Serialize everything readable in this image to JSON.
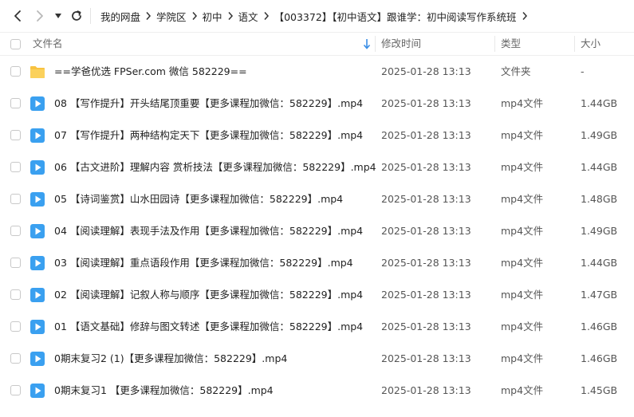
{
  "toolbar": {
    "back_icon": "chevron-left-icon",
    "forward_icon": "chevron-right-icon",
    "history_icon": "caret-down-icon",
    "refresh_icon": "refresh-icon",
    "breadcrumbs": [
      "我的网盘",
      "学院区",
      "初中",
      "语文",
      "【003372】【初中语文】跟谁学：初中阅读写作系统班"
    ]
  },
  "header": {
    "name": "文件名",
    "sort_icon": "arrow-down-icon",
    "modified": "修改时间",
    "type": "类型",
    "size": "大小"
  },
  "colors": {
    "accent": "#3a8ee6",
    "folder": "#f8c240",
    "video": "#3aa0f0"
  },
  "files": [
    {
      "icon": "folder-icon",
      "name": "==学爸优选 FPSer.com 微信 582229==",
      "date": "2025-01-28 13:13",
      "type": "文件夹",
      "size": "-"
    },
    {
      "icon": "video-file-icon",
      "name": "08 【写作提升】开头结尾顶重要【更多课程加微信：582229】.mp4",
      "date": "2025-01-28 13:13",
      "type": "mp4文件",
      "size": "1.44GB"
    },
    {
      "icon": "video-file-icon",
      "name": "07 【写作提升】两种结构定天下【更多课程加微信：582229】.mp4",
      "date": "2025-01-28 13:13",
      "type": "mp4文件",
      "size": "1.49GB"
    },
    {
      "icon": "video-file-icon",
      "name": "06 【古文进阶】理解内容 赏析技法【更多课程加微信：582229】.mp4",
      "date": "2025-01-28 13:13",
      "type": "mp4文件",
      "size": "1.44GB"
    },
    {
      "icon": "video-file-icon",
      "name": "05 【诗词鉴赏】山水田园诗【更多课程加微信：582229】.mp4",
      "date": "2025-01-28 13:13",
      "type": "mp4文件",
      "size": "1.48GB"
    },
    {
      "icon": "video-file-icon",
      "name": "04 【阅读理解】表现手法及作用【更多课程加微信：582229】.mp4",
      "date": "2025-01-28 13:13",
      "type": "mp4文件",
      "size": "1.49GB"
    },
    {
      "icon": "video-file-icon",
      "name": "03 【阅读理解】重点语段作用【更多课程加微信：582229】.mp4",
      "date": "2025-01-28 13:13",
      "type": "mp4文件",
      "size": "1.44GB"
    },
    {
      "icon": "video-file-icon",
      "name": "02 【阅读理解】记叙人称与顺序【更多课程加微信：582229】.mp4",
      "date": "2025-01-28 13:13",
      "type": "mp4文件",
      "size": "1.47GB"
    },
    {
      "icon": "video-file-icon",
      "name": "01 【语文基础】修辞与图文转述【更多课程加微信：582229】.mp4",
      "date": "2025-01-28 13:13",
      "type": "mp4文件",
      "size": "1.46GB"
    },
    {
      "icon": "video-file-icon",
      "name": "0期末复习2 (1)【更多课程加微信：582229】.mp4",
      "date": "2025-01-28 13:13",
      "type": "mp4文件",
      "size": "1.46GB"
    },
    {
      "icon": "video-file-icon",
      "name": "0期末复习1 【更多课程加微信：582229】.mp4",
      "date": "2025-01-28 13:13",
      "type": "mp4文件",
      "size": "1.45GB"
    }
  ]
}
